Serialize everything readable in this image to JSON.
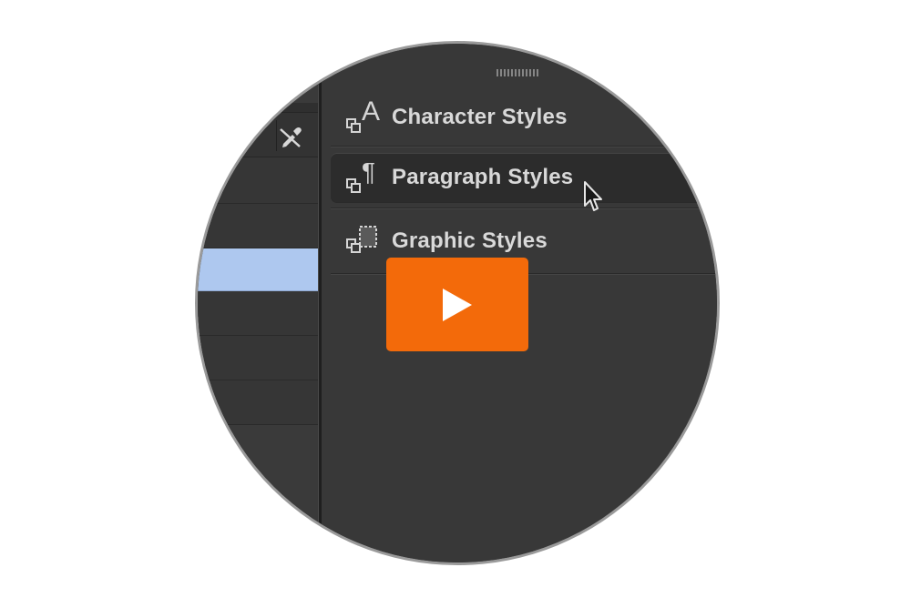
{
  "styles_menu": {
    "items": [
      {
        "label": "Character Styles",
        "icon": "character-styles-icon",
        "glyph": "A"
      },
      {
        "label": "Paragraph Styles",
        "icon": "paragraph-styles-icon",
        "glyph": "¶"
      },
      {
        "label": "Graphic Styles",
        "icon": "graphic-styles-icon",
        "glyph": ""
      }
    ],
    "hovered_item": "Paragraph Styles"
  },
  "left_panel": {
    "tool_icon": "eyedropper-icon",
    "selected_row_color": "#aec8ef"
  },
  "video": {
    "play_button_color": "#f36a0a",
    "play_icon": "play-icon"
  }
}
